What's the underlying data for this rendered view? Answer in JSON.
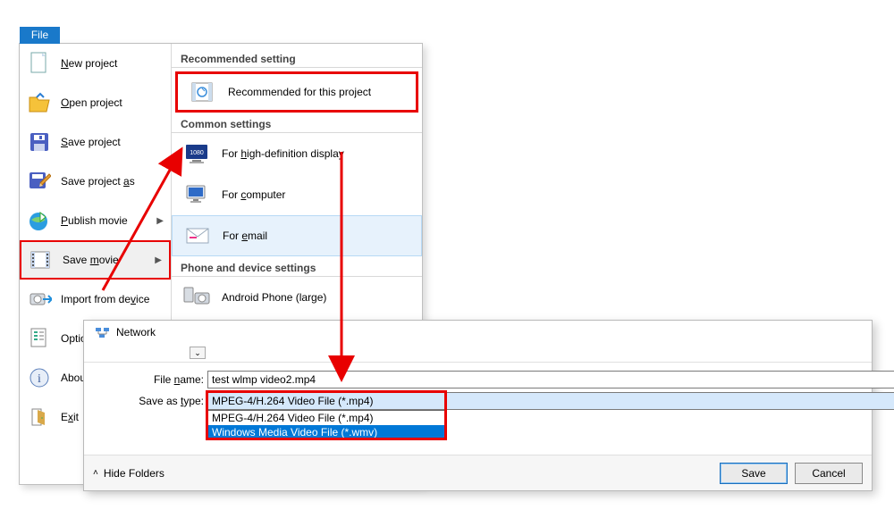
{
  "file_tab": "File",
  "menu": {
    "new_project": "New project",
    "open_project": "Open project",
    "save_project": "Save project",
    "save_project_as": "Save project as",
    "publish_movie": "Publish movie",
    "save_movie": "Save movie",
    "import_from_device": "Import from device",
    "options": "Options",
    "about": "About",
    "exit": "Exit"
  },
  "sections": {
    "recommended_header": "Recommended setting",
    "recommended_item": "Recommended for this project",
    "common_header": "Common settings",
    "hd_display": "For high-definition display",
    "for_computer": "For computer",
    "for_email": "For email",
    "phone_header": "Phone and device settings",
    "android_large": "Android Phone (large)"
  },
  "dialog": {
    "location": "Network",
    "filename_label": "File name:",
    "filename_value": "test wlmp video2.mp4",
    "type_label": "Save as type:",
    "type_selected": "MPEG-4/H.264 Video File (*.mp4)",
    "type_options": [
      "MPEG-4/H.264 Video File (*.mp4)",
      "Windows Media Video File (*.wmv)"
    ],
    "hide_folders": "Hide Folders",
    "save_btn": "Save",
    "cancel_btn": "Cancel"
  }
}
